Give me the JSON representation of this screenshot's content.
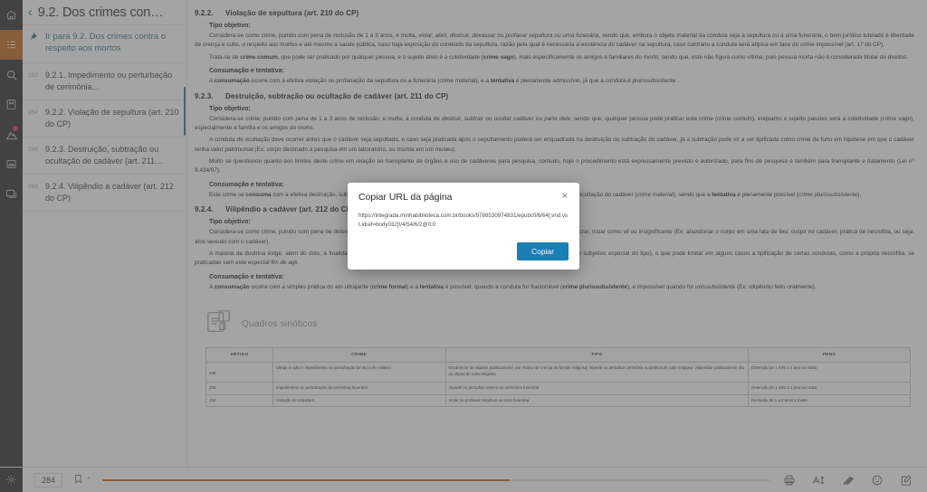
{
  "rail": {
    "items": [
      {
        "name": "home-icon",
        "label": "Início"
      },
      {
        "name": "toc-icon",
        "label": "Sumário",
        "active": true
      },
      {
        "name": "search-icon",
        "label": "Pesquisar"
      },
      {
        "name": "bookmark-icon",
        "label": "Marcadores"
      },
      {
        "name": "highlights-icon",
        "label": "Destaques"
      },
      {
        "name": "flashcards-icon",
        "label": "Flashcards"
      },
      {
        "name": "notes-icon",
        "label": "Notas"
      }
    ],
    "settings_label": "Configurações"
  },
  "toc": {
    "back_glyph": "‹",
    "title": "9.2. Dos crimes con…",
    "goto_label": "Ir para 9.2. Dos crimes contra o respeito aos mortos",
    "items": [
      {
        "page": "283",
        "label": "9.2.1. Impedimento ou perturbação de cerimônia…"
      },
      {
        "page": "284",
        "label": "9.2.2. Violação de sepultura (art. 210 do CP)"
      },
      {
        "page": "286",
        "label": "9.2.3. Destruição, subtração ou ocultação de cadáver (art. 211…"
      },
      {
        "page": "288",
        "label": "9.2.4. Vilipêndio a cadáver (art. 212 do CP)"
      }
    ]
  },
  "reader": {
    "sections": [
      {
        "num": "9.2.2.",
        "title": "Violação de sepultura (art. 210 do CP)",
        "sub1": "Tipo objetivo:",
        "p1_a": "Considera-se como crime, punido com pena de reclusão de 1 a 3 anos, e multa, ",
        "p1_it": "violar, abrir, destruir, devassar ou profanar sepultura ou urna funerária",
        "p1_b": ", sendo que, embora o objeto material da conduta seja a sepultura ou a urna funerária, o bem jurídico tutelado é liberdade de crença e culto, o respeito aos mortos e até mesmo a saúde pública, caso haja exposição do conteúdo da sepultura, razão pela qual é necessária a existência do cadáver na sepultura, caso contrário a conduta será atípica em face do crime impossível (art. 17 do CP).",
        "p2_a": "Trata-se de ",
        "p2_bd": "crime comum",
        "p2_b": ", que pode ser praticado por qualquer pessoa, e o sujeito ativo é a coletividade (",
        "p2_bd2": "crime vago",
        "p2_c": "), mais especificamente os amigos e familiares do morto, sendo que, este não figura como vítima, pois pessoa morta não é considerada titular de direitos.",
        "sub2": "Consumação e tentativa:",
        "p3_a": "A ",
        "p3_bd": "consumação",
        "p3_b": " ocorre com a efetiva violação ou profanação da sepultura ou a funerária (crime material), e a ",
        "p3_bd2": "tentativa",
        "p3_c": " é plenamente admissível, já que a conduta é plurissubsistente."
      },
      {
        "num": "9.2.3.",
        "title": "Destruição, subtração ou ocultação de cadáver (art. 211 do CP)",
        "sub1": "Tipo objetivo:",
        "p1_a": "Considera-se crime, punido com pena de 1 a 3 anos de reclusão, e multa, a conduta de ",
        "p1_it": "destruir, subtrair ou ocultar cadáver ou parte dele",
        "p1_b": ", sendo que, qualquer pessoa pode praticar este crime (crime comum), enquanto o sujeito passivo será a coletividade (crime vago), especialmente a família e os amigos do morto.",
        "p2": "A conduta de ocultação deve ocorrer antes que o cadáver seja sepultado, e caso seja praticada após o sepultamento poderá ser enquadrada na destruição ou subtração do cadáver, já a subtração pode vir a ser tipificada como crime de furto em hipótese em que o cadáver tenha valor patrimonial (Ex: corpo destinado à pesquisa em um laboratório, ou múmia em um museu).",
        "p3": "Muito se questionou quanto aos limites deste crime em relação ao transplante de órgãos e uso de cadáveres para pesquisa, contudo, hoje o procedimento está expressamente previsto e autorizado, para fins de pesquisa e também para transplante e tratamento (Lei n° 9.434/97).",
        "sub2": "Consumação e tentativa:",
        "p4_a": "Este crime se ",
        "p4_bd": "consuma",
        "p4_b": " com a efetiva destruição, subtração ou ocultação do cadáver ou de partes deste, ou ainda, com o desaparecimento ou ocultação do cadáver (",
        "p4_it": "crime material",
        "p4_c": "), sendo que a ",
        "p4_bd2": "tentativa",
        "p4_d": " é plenamente possível (",
        "p4_it2": "crime plurissubsistente",
        "p4_e": ")."
      },
      {
        "num": "9.2.4.",
        "title": "Vilipêndio a cadáver (art. 212 do CP)",
        "sub1": "Tipo objetivo:",
        "p1": "Considera-se como crime, punido com pena de detenção de 1 a 3 anos, e multa, vilipendiar cadáver ou suas cinzas, vilipendiar significa desprezar, tratar como vil ou insignificante (Ex: abandonar o corpo em uma lata de lixo; cuspir no cadáver, prática de necrofilia, ou seja, atos sexuais com o cadáver).",
        "p2_a": "A maioria da doutrina exige, além do dolo, a finalidade de ultrajar, desrespeitar memória do defunto e da dignidade de sua família (elemento subjetivo especial do tipo), o que pode limitar em alguns casos a tipificação de certas condutas, como a própria necrofilia, se praticadas sem este ",
        "p2_it": "especial fim de agir",
        "p2_b": ".",
        "sub2": "Consumação e tentativa:",
        "p3_a": "A ",
        "p3_bd": "consumação",
        "p3_b": " ocorre com a simples prática do ato ultrajante (",
        "p3_bd2": "crime formal",
        "p3_c": ") e a ",
        "p3_bd3": "tentativa",
        "p3_d": " é possível, quando a conduta for fracionável (",
        "p3_bd4": "crime plurissubsistente",
        "p3_e": "), e impossível quando for ",
        "p3_it": "unissubsistente",
        "p3_f": " (Ex: vilipêndio feito oralmente)."
      }
    ],
    "quadros_label": "Quadros sinóticos"
  },
  "table": {
    "headers": [
      "ARTIGO",
      "CRIME",
      "TIPO",
      "PENA"
    ],
    "rows": [
      {
        "artigo": "208",
        "crime": "Ultraje a culto e impedimento ou perturbação de ato a ele relativo",
        "tipo": "Escarnecer de alguém publicamente, por motivo de crença ou função religiosa; impedir ou perturbar cerimônia ou prática de culto religioso; vilipendiar publicamente ato ou objeto de culto religioso",
        "pena": "Detenção de 1 mês a 1 ano ou multa"
      },
      {
        "artigo": "209",
        "crime": "Impedimento ou perturbação de cerimônia funerária",
        "tipo": "Impedir ou perturbar enterro ou cerimônia funerária",
        "pena": "Detenção de 1 mês a 1 ano ou multa"
      },
      {
        "artigo": "210",
        "crime": "Violação de sepultura",
        "tipo": "Violar ou profanar sepultura ou urna funerária",
        "pena": "Reclusão de 1 a 3 anos e multa"
      }
    ]
  },
  "bottombar": {
    "page_value": "284",
    "bookmark_icon": "bookmark-icon",
    "chevron": "⌃",
    "progress_percent": 61,
    "tools": [
      {
        "name": "print-icon",
        "label": "Imprimir"
      },
      {
        "name": "font-size-icon",
        "label": "Tamanho da fonte"
      },
      {
        "name": "highlighter-icon",
        "label": "Marca-texto"
      },
      {
        "name": "emoji-icon",
        "label": "Reações"
      },
      {
        "name": "note-icon",
        "label": "Anotações"
      }
    ]
  },
  "modal": {
    "title": "Copiar URL da página",
    "close_glyph": "×",
    "url": "https://integrada.minhabiblioteca.com.br/books/9788530974831/epubcfi/6/64[;vnd.vst.idref=body032]!/4/54/6/2@0:0",
    "copy_label": "Copiar",
    "accent_color": "#1a7fb5"
  },
  "colors": {
    "rail_bg": "#262626",
    "accent_orange": "#c4620e",
    "link_blue": "#3b6b80",
    "button_blue": "#1a7fb5"
  }
}
